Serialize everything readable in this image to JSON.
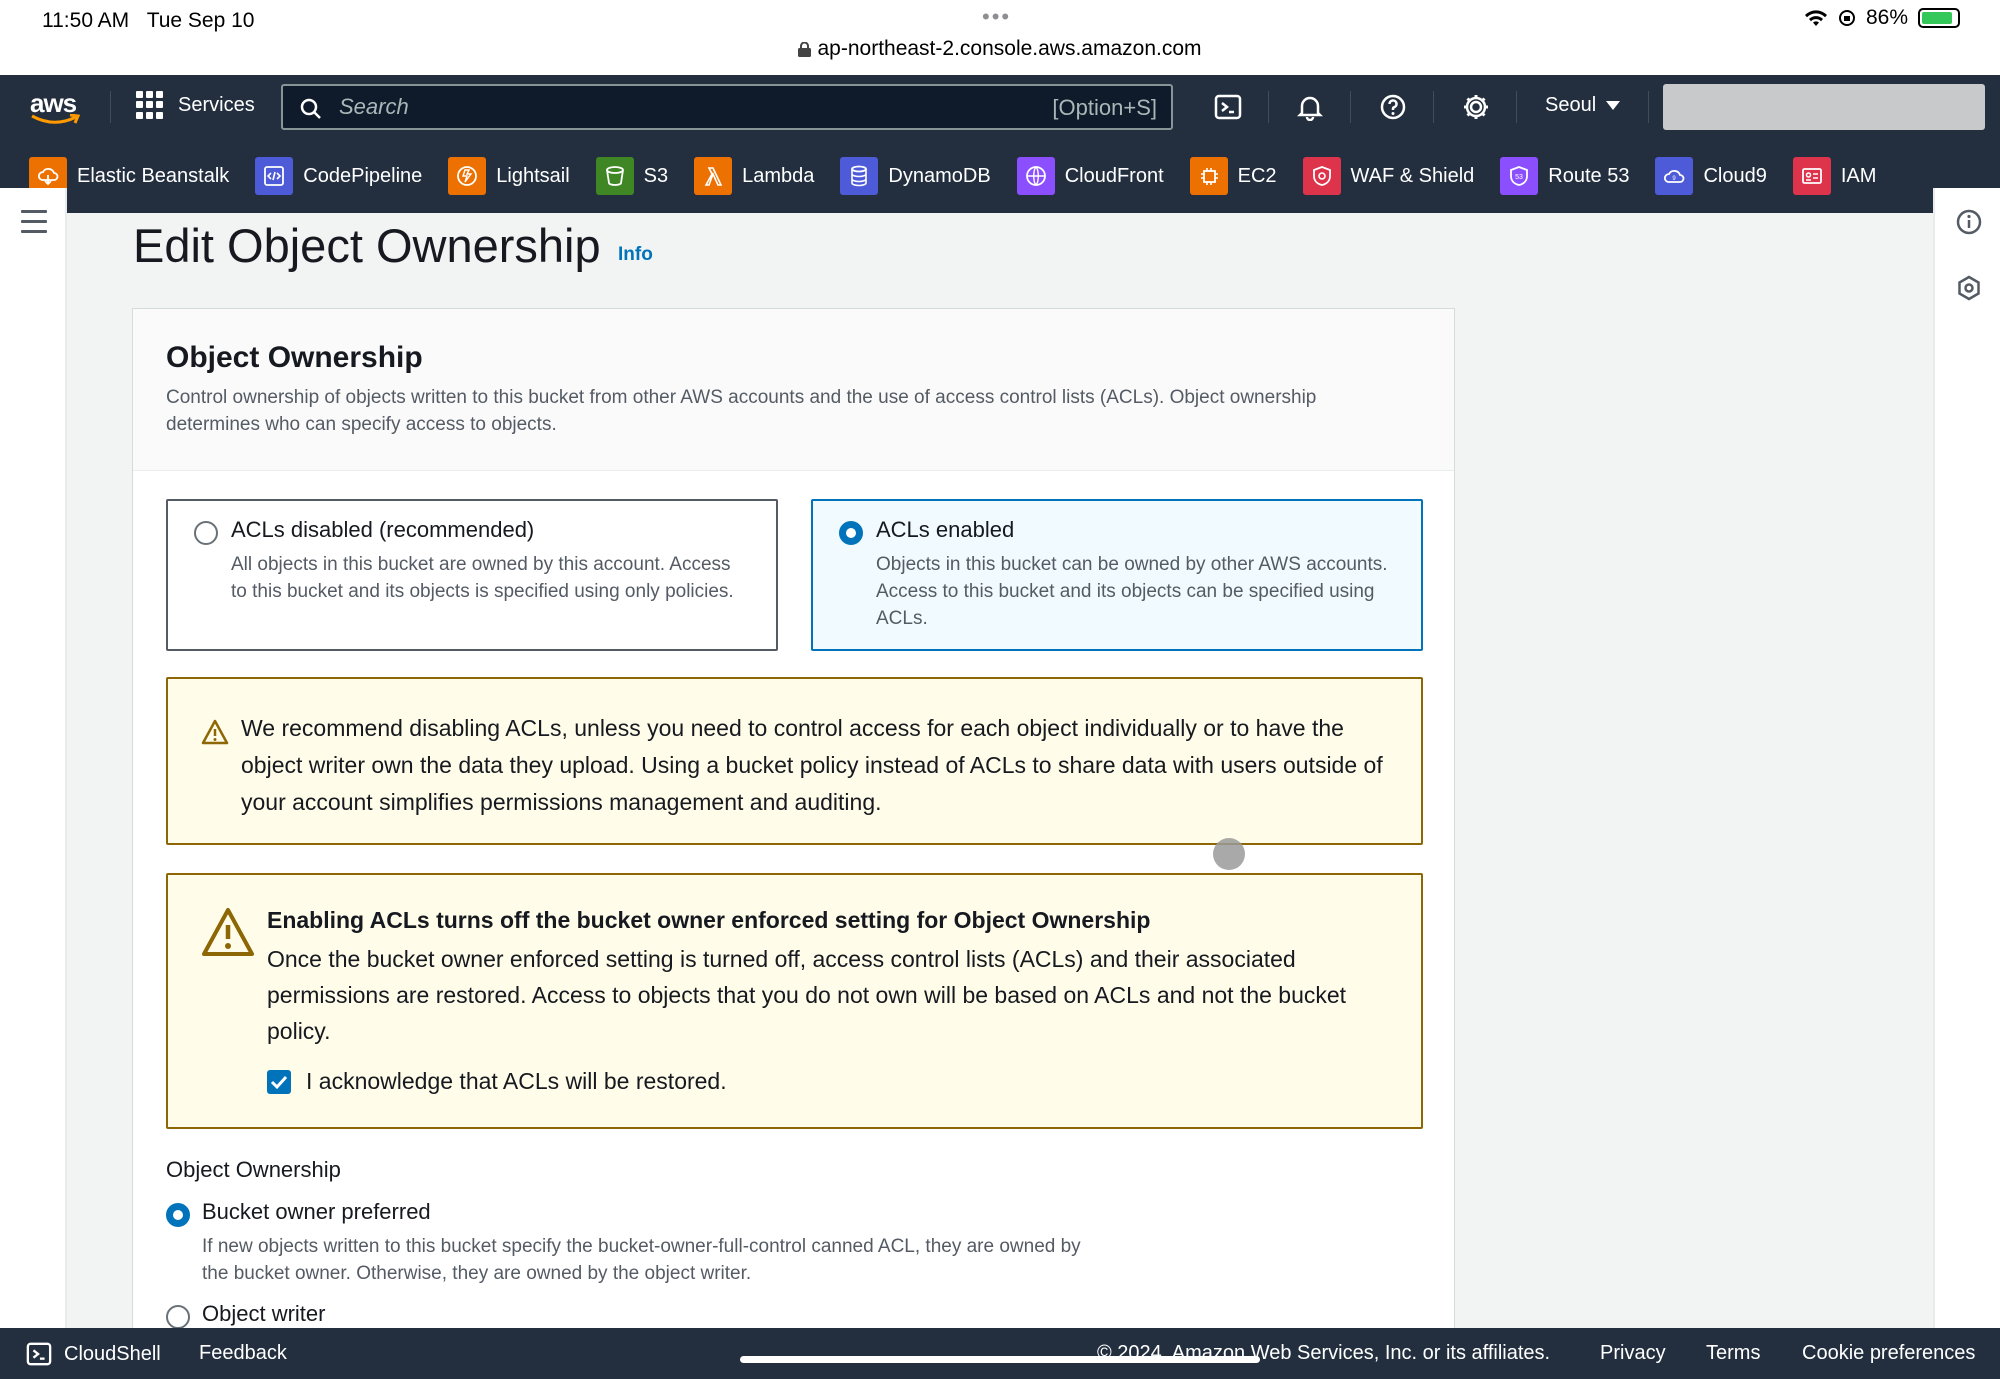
{
  "status_bar": {
    "time": "11:50 AM",
    "date": "Tue Sep 10",
    "url": "ap-northeast-2.console.aws.amazon.com",
    "battery": "86%"
  },
  "nav": {
    "logo": "aws",
    "services_label": "Services",
    "search_placeholder": "Search",
    "search_shortcut": "[Option+S]",
    "region": "Seoul",
    "favorites": [
      {
        "label": "Elastic Beanstalk",
        "icon": "elastic-beanstalk-icon",
        "color": "#ed7100"
      },
      {
        "label": "CodePipeline",
        "icon": "codepipeline-icon",
        "color": "#4d5bd8"
      },
      {
        "label": "Lightsail",
        "icon": "lightsail-icon",
        "color": "#ed7100"
      },
      {
        "label": "S3",
        "icon": "s3-icon",
        "color": "#3f8624"
      },
      {
        "label": "Lambda",
        "icon": "lambda-icon",
        "color": "#ed7100"
      },
      {
        "label": "DynamoDB",
        "icon": "dynamodb-icon",
        "color": "#4d5bd8"
      },
      {
        "label": "CloudFront",
        "icon": "cloudfront-icon",
        "color": "#8c4fff"
      },
      {
        "label": "EC2",
        "icon": "ec2-icon",
        "color": "#ed7100"
      },
      {
        "label": "WAF & Shield",
        "icon": "waf-shield-icon",
        "color": "#dd344c"
      },
      {
        "label": "Route 53",
        "icon": "route53-icon",
        "color": "#8c4fff"
      },
      {
        "label": "Cloud9",
        "icon": "cloud9-icon",
        "color": "#4d5bd8"
      },
      {
        "label": "IAM",
        "icon": "iam-icon",
        "color": "#dd344c"
      }
    ]
  },
  "page": {
    "title": "Edit Object Ownership",
    "info_link": "Info"
  },
  "card": {
    "title": "Object Ownership",
    "description": "Control ownership of objects written to this bucket from other AWS accounts and the use of access control lists (ACLs). Object ownership determines who can specify access to objects.",
    "tiles": [
      {
        "label": "ACLs disabled (recommended)",
        "description": "All objects in this bucket are owned by this account. Access to this bucket and its objects is specified using only policies.",
        "selected": false
      },
      {
        "label": "ACLs enabled",
        "description": "Objects in this bucket can be owned by other AWS accounts. Access to this bucket and its objects can be specified using ACLs.",
        "selected": true
      }
    ],
    "warning1": "We recommend disabling ACLs, unless you need to control access for each object individually or to have the object writer own the data they upload. Using a bucket policy instead of ACLs to share data with users outside of your account simplifies permissions management and auditing.",
    "warning2": {
      "title": "Enabling ACLs turns off the bucket owner enforced setting for Object Ownership",
      "text": "Once the bucket owner enforced setting is turned off, access control lists (ACLs) and their associated permissions are restored. Access to objects that you do not own will be based on ACLs and not the bucket policy.",
      "acknowledge_label": "I acknowledge that ACLs will be restored.",
      "acknowledged": true
    },
    "ownership": {
      "label": "Object Ownership",
      "options": [
        {
          "label": "Bucket owner preferred",
          "description": "If new objects written to this bucket specify the bucket-owner-full-control canned ACL, they are owned by the bucket owner. Otherwise, they are owned by the object writer.",
          "selected": true
        },
        {
          "label": "Object writer",
          "selected": false
        }
      ]
    }
  },
  "footer": {
    "cloudshell": "CloudShell",
    "feedback": "Feedback",
    "copyright": "© 2024, Amazon Web Services, Inc. or its affiliates.",
    "privacy": "Privacy",
    "terms": "Terms",
    "cookies": "Cookie preferences"
  }
}
